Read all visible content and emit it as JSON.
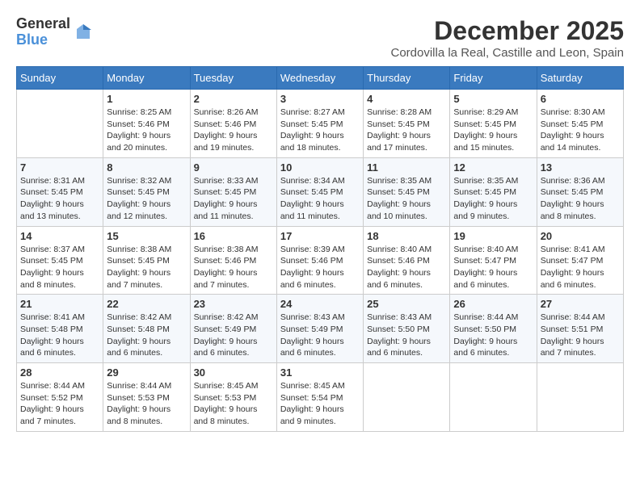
{
  "logo": {
    "general": "General",
    "blue": "Blue"
  },
  "title": "December 2025",
  "subtitle": "Cordovilla la Real, Castille and Leon, Spain",
  "days_header": [
    "Sunday",
    "Monday",
    "Tuesday",
    "Wednesday",
    "Thursday",
    "Friday",
    "Saturday"
  ],
  "weeks": [
    [
      {
        "day": "",
        "info": ""
      },
      {
        "day": "1",
        "info": "Sunrise: 8:25 AM\nSunset: 5:46 PM\nDaylight: 9 hours\nand 20 minutes."
      },
      {
        "day": "2",
        "info": "Sunrise: 8:26 AM\nSunset: 5:46 PM\nDaylight: 9 hours\nand 19 minutes."
      },
      {
        "day": "3",
        "info": "Sunrise: 8:27 AM\nSunset: 5:45 PM\nDaylight: 9 hours\nand 18 minutes."
      },
      {
        "day": "4",
        "info": "Sunrise: 8:28 AM\nSunset: 5:45 PM\nDaylight: 9 hours\nand 17 minutes."
      },
      {
        "day": "5",
        "info": "Sunrise: 8:29 AM\nSunset: 5:45 PM\nDaylight: 9 hours\nand 15 minutes."
      },
      {
        "day": "6",
        "info": "Sunrise: 8:30 AM\nSunset: 5:45 PM\nDaylight: 9 hours\nand 14 minutes."
      }
    ],
    [
      {
        "day": "7",
        "info": "Sunrise: 8:31 AM\nSunset: 5:45 PM\nDaylight: 9 hours\nand 13 minutes."
      },
      {
        "day": "8",
        "info": "Sunrise: 8:32 AM\nSunset: 5:45 PM\nDaylight: 9 hours\nand 12 minutes."
      },
      {
        "day": "9",
        "info": "Sunrise: 8:33 AM\nSunset: 5:45 PM\nDaylight: 9 hours\nand 11 minutes."
      },
      {
        "day": "10",
        "info": "Sunrise: 8:34 AM\nSunset: 5:45 PM\nDaylight: 9 hours\nand 11 minutes."
      },
      {
        "day": "11",
        "info": "Sunrise: 8:35 AM\nSunset: 5:45 PM\nDaylight: 9 hours\nand 10 minutes."
      },
      {
        "day": "12",
        "info": "Sunrise: 8:35 AM\nSunset: 5:45 PM\nDaylight: 9 hours\nand 9 minutes."
      },
      {
        "day": "13",
        "info": "Sunrise: 8:36 AM\nSunset: 5:45 PM\nDaylight: 9 hours\nand 8 minutes."
      }
    ],
    [
      {
        "day": "14",
        "info": "Sunrise: 8:37 AM\nSunset: 5:45 PM\nDaylight: 9 hours\nand 8 minutes."
      },
      {
        "day": "15",
        "info": "Sunrise: 8:38 AM\nSunset: 5:45 PM\nDaylight: 9 hours\nand 7 minutes."
      },
      {
        "day": "16",
        "info": "Sunrise: 8:38 AM\nSunset: 5:46 PM\nDaylight: 9 hours\nand 7 minutes."
      },
      {
        "day": "17",
        "info": "Sunrise: 8:39 AM\nSunset: 5:46 PM\nDaylight: 9 hours\nand 6 minutes."
      },
      {
        "day": "18",
        "info": "Sunrise: 8:40 AM\nSunset: 5:46 PM\nDaylight: 9 hours\nand 6 minutes."
      },
      {
        "day": "19",
        "info": "Sunrise: 8:40 AM\nSunset: 5:47 PM\nDaylight: 9 hours\nand 6 minutes."
      },
      {
        "day": "20",
        "info": "Sunrise: 8:41 AM\nSunset: 5:47 PM\nDaylight: 9 hours\nand 6 minutes."
      }
    ],
    [
      {
        "day": "21",
        "info": "Sunrise: 8:41 AM\nSunset: 5:48 PM\nDaylight: 9 hours\nand 6 minutes."
      },
      {
        "day": "22",
        "info": "Sunrise: 8:42 AM\nSunset: 5:48 PM\nDaylight: 9 hours\nand 6 minutes."
      },
      {
        "day": "23",
        "info": "Sunrise: 8:42 AM\nSunset: 5:49 PM\nDaylight: 9 hours\nand 6 minutes."
      },
      {
        "day": "24",
        "info": "Sunrise: 8:43 AM\nSunset: 5:49 PM\nDaylight: 9 hours\nand 6 minutes."
      },
      {
        "day": "25",
        "info": "Sunrise: 8:43 AM\nSunset: 5:50 PM\nDaylight: 9 hours\nand 6 minutes."
      },
      {
        "day": "26",
        "info": "Sunrise: 8:44 AM\nSunset: 5:50 PM\nDaylight: 9 hours\nand 6 minutes."
      },
      {
        "day": "27",
        "info": "Sunrise: 8:44 AM\nSunset: 5:51 PM\nDaylight: 9 hours\nand 7 minutes."
      }
    ],
    [
      {
        "day": "28",
        "info": "Sunrise: 8:44 AM\nSunset: 5:52 PM\nDaylight: 9 hours\nand 7 minutes."
      },
      {
        "day": "29",
        "info": "Sunrise: 8:44 AM\nSunset: 5:53 PM\nDaylight: 9 hours\nand 8 minutes."
      },
      {
        "day": "30",
        "info": "Sunrise: 8:45 AM\nSunset: 5:53 PM\nDaylight: 9 hours\nand 8 minutes."
      },
      {
        "day": "31",
        "info": "Sunrise: 8:45 AM\nSunset: 5:54 PM\nDaylight: 9 hours\nand 9 minutes."
      },
      {
        "day": "",
        "info": ""
      },
      {
        "day": "",
        "info": ""
      },
      {
        "day": "",
        "info": ""
      }
    ]
  ]
}
